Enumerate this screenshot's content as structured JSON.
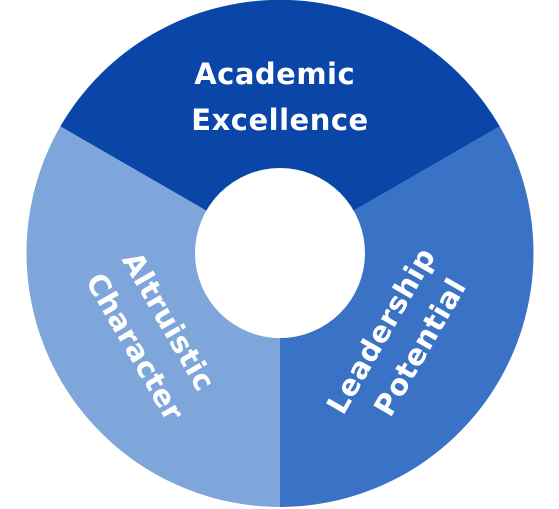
{
  "diagram": {
    "segments": [
      {
        "id": "academic",
        "lines": [
          "Academic",
          "Excellence"
        ],
        "color": "#0a45a8"
      },
      {
        "id": "leadership",
        "lines": [
          "Leadership",
          "Potential"
        ],
        "color": "#3a72c6"
      },
      {
        "id": "altruistic",
        "lines": [
          "Altruistic",
          "Character"
        ],
        "color": "#7fa6da"
      }
    ],
    "center_color": "#ffffff"
  }
}
